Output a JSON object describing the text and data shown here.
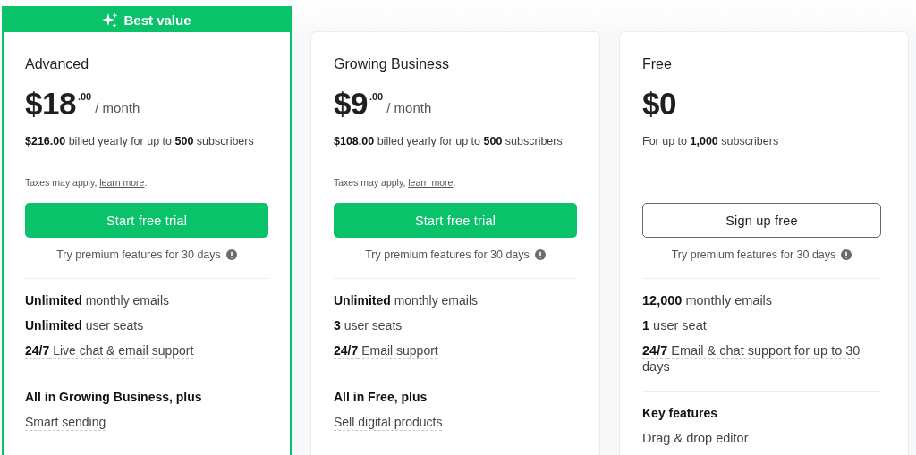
{
  "plans": [
    {
      "badge": {
        "text": "Best value"
      },
      "name": "Advanced",
      "price": {
        "amount": "$18",
        "cents": ".00",
        "period": "/ month"
      },
      "billing": "**$216.00** billed yearly for up to **500** subscribers",
      "taxes": {
        "text": "Taxes may apply, ",
        "link": "learn more",
        "end": "."
      },
      "button": {
        "label": "Start free trial",
        "kind": "filled"
      },
      "trial_note": "Try premium features for 30 days",
      "features": [
        {
          "text": "**Unlimited** monthly emails",
          "tooltip": false
        },
        {
          "text": "**Unlimited** user seats",
          "tooltip": false
        },
        {
          "text": "**24/7** Live chat & email support",
          "tooltip": true
        }
      ],
      "section": {
        "heading": "All in Growing Business, plus",
        "items": [
          {
            "text": "Smart sending",
            "tooltip": true
          }
        ]
      }
    },
    {
      "name": "Growing Business",
      "price": {
        "amount": "$9",
        "cents": ".00",
        "period": "/ month"
      },
      "billing": "**$108.00** billed yearly for up to **500** subscribers",
      "taxes": {
        "text": "Taxes may apply, ",
        "link": "learn more",
        "end": "."
      },
      "button": {
        "label": "Start free trial",
        "kind": "filled"
      },
      "trial_note": "Try premium features for 30 days",
      "features": [
        {
          "text": "**Unlimited** monthly emails",
          "tooltip": false
        },
        {
          "text": "**3** user seats",
          "tooltip": false
        },
        {
          "text": "**24/7** Email support",
          "tooltip": true
        }
      ],
      "section": {
        "heading": "All in Free, plus",
        "items": [
          {
            "text": "Sell digital products",
            "tooltip": true
          }
        ]
      }
    },
    {
      "name": "Free",
      "price": {
        "amount": "$0"
      },
      "billing": "For up to **1,000** subscribers",
      "button": {
        "label": "Sign up free",
        "kind": "outline"
      },
      "trial_note": "Try premium features for 30 days",
      "features": [
        {
          "text": "**12,000** monthly emails",
          "tooltip": false
        },
        {
          "text": "**1** user seat",
          "tooltip": false
        },
        {
          "text": "**24/7** Email & chat support for up to 30 days",
          "tooltip": true
        }
      ],
      "section": {
        "heading": "Key features",
        "items": [
          {
            "text": "Drag & drop editor",
            "tooltip": false
          }
        ]
      }
    }
  ]
}
